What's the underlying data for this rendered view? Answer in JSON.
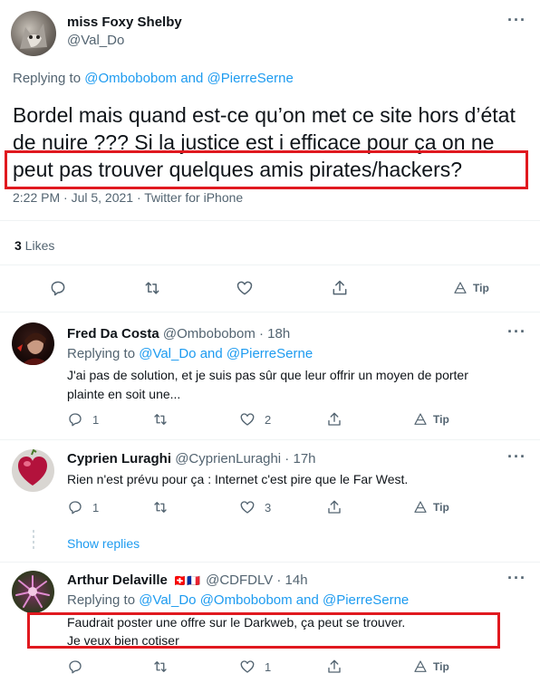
{
  "main_tweet": {
    "author_name": "miss Foxy Shelby",
    "author_handle": "@Val_Do",
    "replying_prefix": "Replying to ",
    "replying_to": "@Ombobobom and @PierreSerne",
    "text_line1": "Bordel mais quand est-ce qu’on met ce site hors d’état",
    "text_line2": "de nuire ??? Si la justice est i efficace pour ça on ne",
    "text_line3": "peut pas trouver quelques amis pirates/hackers?",
    "meta": "2:22 PM · Jul 5, 2021 · Twitter for iPhone",
    "likes_count": "3",
    "likes_label": " Likes",
    "tip_label": "Tip"
  },
  "replies": [
    {
      "author_name": "Fred Da Costa",
      "handle_time": "@Ombobobom · 18h",
      "replying_prefix": "Replying to ",
      "replying_to": "@Val_Do and @PierreSerne",
      "text_line1": "J'ai pas de solution, et je suis pas sûr que leur offrir un moyen de porter",
      "text_line2": "plainte en soit une...",
      "reply_count": "1",
      "retweet_count": "",
      "like_count": "2",
      "tip_label": "Tip"
    },
    {
      "author_name": "Cyprien Luraghi",
      "handle_time": "@CyprienLuraghi · 17h",
      "text_line1": "Rien n'est prévu pour ça : Internet c'est pire que le Far West.",
      "reply_count": "1",
      "retweet_count": "",
      "like_count": "3",
      "tip_label": "Tip",
      "show_replies": "Show replies"
    },
    {
      "author_name": "Arthur Delaville",
      "flags": "🇨🇭🇫🇷",
      "handle_time": "@CDFDLV · 14h",
      "replying_prefix": "Replying to ",
      "replying_to": "@Val_Do @Ombobobom and @PierreSerne",
      "text_line1": "Faudrait poster une offre sur le Darkweb, ça peut se trouver.",
      "text_line2": "Je veux bien cotiser",
      "reply_count": "",
      "retweet_count": "",
      "like_count": "1",
      "tip_label": "Tip"
    }
  ],
  "colors": {
    "accent": "#1d9bf0",
    "highlight_box": "#e0191f",
    "muted": "#536471"
  }
}
